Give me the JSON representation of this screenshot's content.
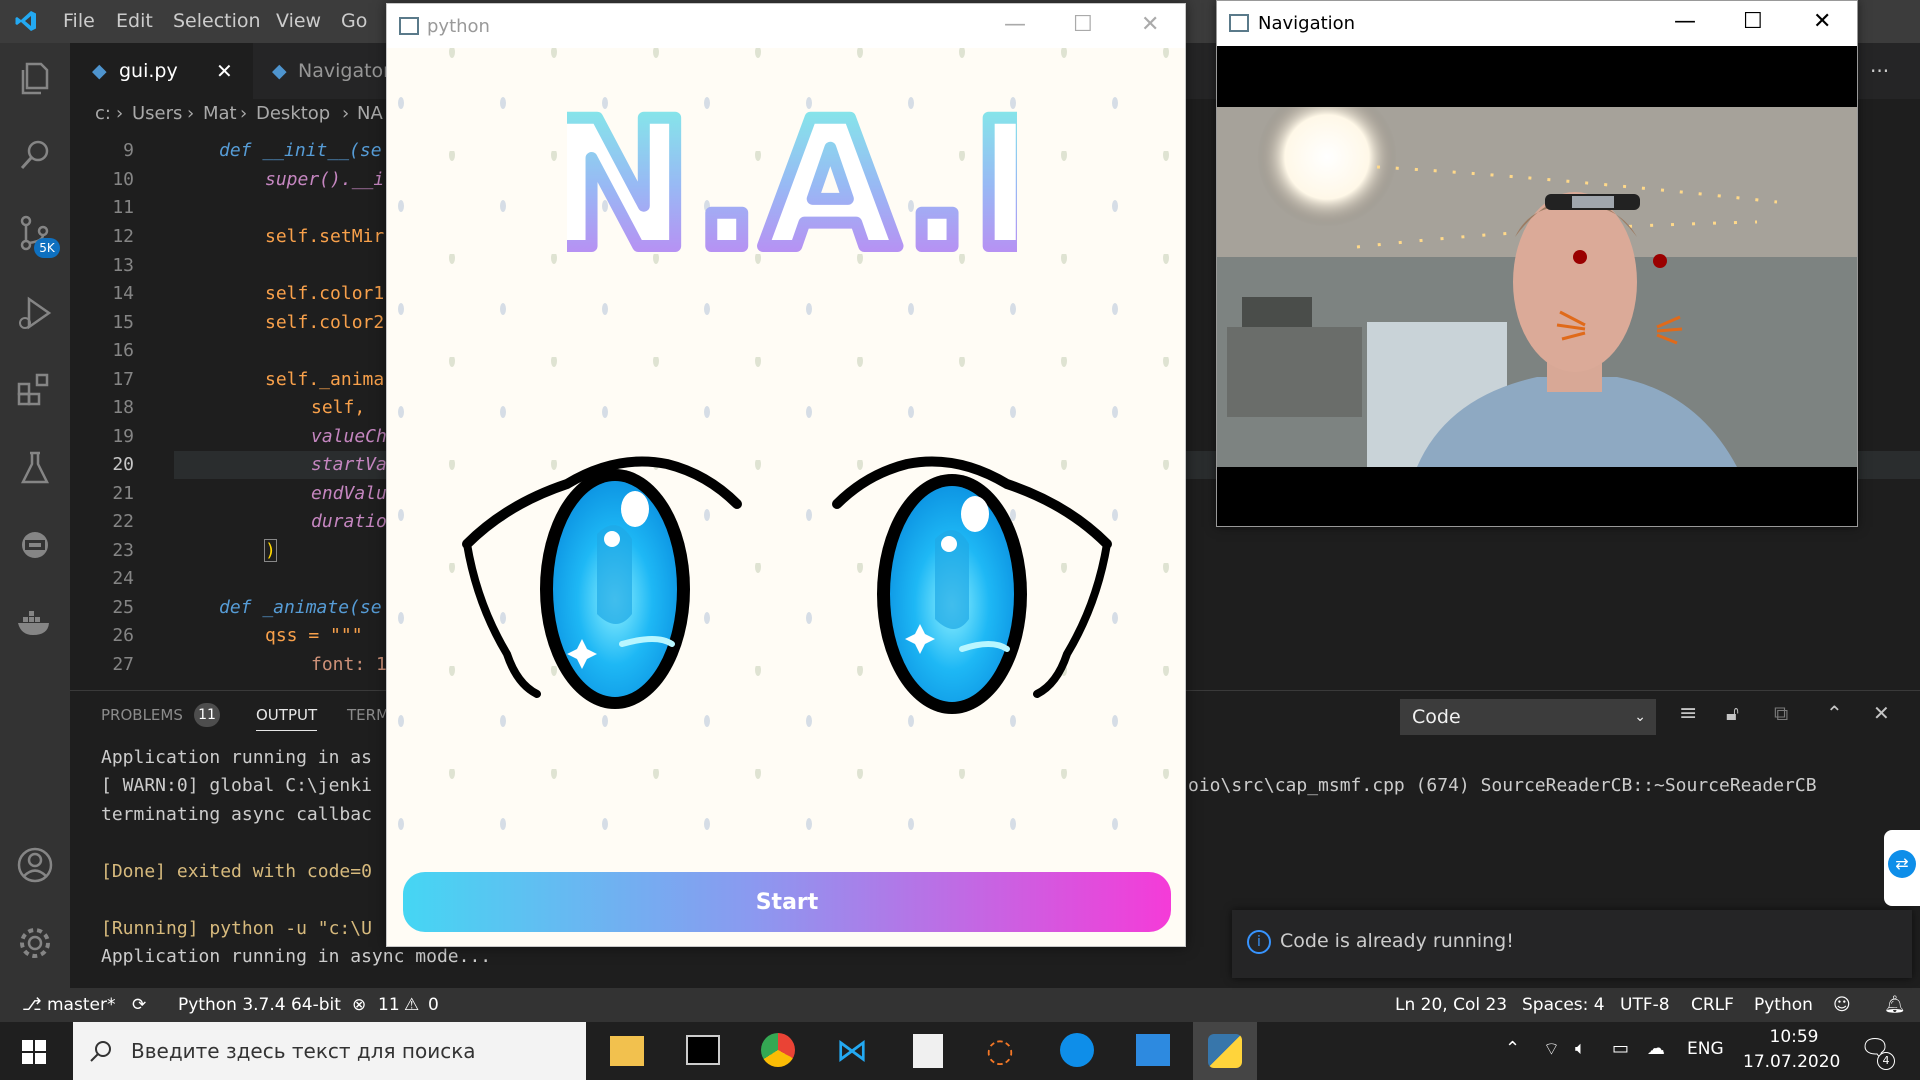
{
  "vscode": {
    "menu": [
      "File",
      "Edit",
      "Selection",
      "View",
      "Go"
    ],
    "tabs": [
      {
        "label": "gui.py",
        "active": true
      },
      {
        "label": "Navigator",
        "active": false
      }
    ],
    "breadcrumb": [
      "c:",
      "Users",
      "Mat",
      "Desktop",
      "NA"
    ],
    "scm_badge": "5K",
    "more_label": "···",
    "code_lines": [
      {
        "n": "9",
        "text": "def __init__(se"
      },
      {
        "n": "10",
        "text": "super().__i"
      },
      {
        "n": "11",
        "text": ""
      },
      {
        "n": "12",
        "text": "self.setMir"
      },
      {
        "n": "13",
        "text": ""
      },
      {
        "n": "14",
        "text": "self.color1"
      },
      {
        "n": "15",
        "text": "self.color2"
      },
      {
        "n": "16",
        "text": ""
      },
      {
        "n": "17",
        "text": "self._anima"
      },
      {
        "n": "18",
        "text": "self,"
      },
      {
        "n": "19",
        "text": "valueCh"
      },
      {
        "n": "20",
        "text": "startVa"
      },
      {
        "n": "21",
        "text": "endValu"
      },
      {
        "n": "22",
        "text": "duratio"
      },
      {
        "n": "23",
        "text": ")"
      },
      {
        "n": "24",
        "text": ""
      },
      {
        "n": "25",
        "text": "def _animate(se"
      },
      {
        "n": "26",
        "text": "qss = \"\"\""
      },
      {
        "n": "27",
        "text": "font: 1"
      }
    ],
    "panel": {
      "problems_label": "PROBLEMS",
      "problems_count": "11",
      "output_label": "OUTPUT",
      "terminal_label": "TERM",
      "channel": "Code"
    },
    "output_lines": [
      "Application running in as",
      "[ WARN:0] global C:\\jenki",
      "terminating async callbac",
      "",
      "[Done] exited with code=0",
      "",
      "[Running] python -u \"c:\\U",
      "Application running in async mode..."
    ],
    "output_right": "oio\\src\\cap_msmf.cpp (674) SourceReaderCB::~SourceReaderCB",
    "status": {
      "branch": "master*",
      "python": "Python 3.7.4 64-bit",
      "errors": "11",
      "warnings": "0",
      "position": "Ln 20, Col 23",
      "spaces": "Spaces: 4",
      "encoding": "UTF-8",
      "eol": "CRLF",
      "language": "Python"
    },
    "toast": "Code is already running!"
  },
  "python_window": {
    "title": "python",
    "logo_text": "N.A.I",
    "start_label": "Start"
  },
  "navigation_window": {
    "title": "Navigation"
  },
  "taskbar": {
    "search_placeholder": "Введите здесь текст для поиска",
    "lang": "ENG",
    "time": "10:59",
    "date": "17.07.2020",
    "notif_count": "4"
  }
}
